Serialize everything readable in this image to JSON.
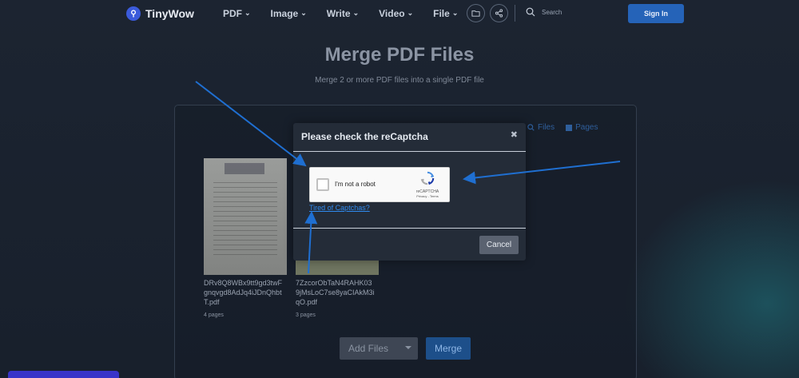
{
  "header": {
    "logo_text": "TinyWow",
    "nav": [
      "PDF",
      "Image",
      "Write",
      "Video",
      "File"
    ],
    "search_placeholder": "Search",
    "signin_label": "Sign In"
  },
  "main": {
    "title": "Merge PDF Files",
    "subtitle": "Merge 2 or more PDF files into a single PDF file",
    "panel_tools": [
      "Files",
      "Pages"
    ],
    "files": [
      {
        "name": "DRv8Q8WBx9tt9gd3twFgnqvgd8AdJq4iJDnQhbtT.pdf",
        "pages": "4 pages"
      },
      {
        "name": "7ZzcorObTaN4RAHK039jMsLoC7se8yaCIAkM3iqO.pdf",
        "pages": "3 pages"
      }
    ],
    "add_files_label": "Add Files",
    "merge_label": "Merge"
  },
  "modal": {
    "title": "Please check the reCaptcha",
    "close_glyph": "✖",
    "captcha_label": "I'm not a robot",
    "captcha_brand": "reCAPTCHA",
    "captcha_links": "Privacy - Terms",
    "tired_link": "Tired of Captchas?",
    "cancel_label": "Cancel"
  },
  "colors": {
    "accent": "#2563b8",
    "background": "#1a2230",
    "modal_bg": "#242c38",
    "link": "#2f8bf0",
    "annotation_arrow": "#1f6fd1"
  },
  "icons": [
    "logo-icon",
    "chevron-down-icon",
    "folder-icon",
    "share-icon",
    "search-icon",
    "close-icon",
    "recaptcha-icon",
    "caret-down-icon"
  ]
}
